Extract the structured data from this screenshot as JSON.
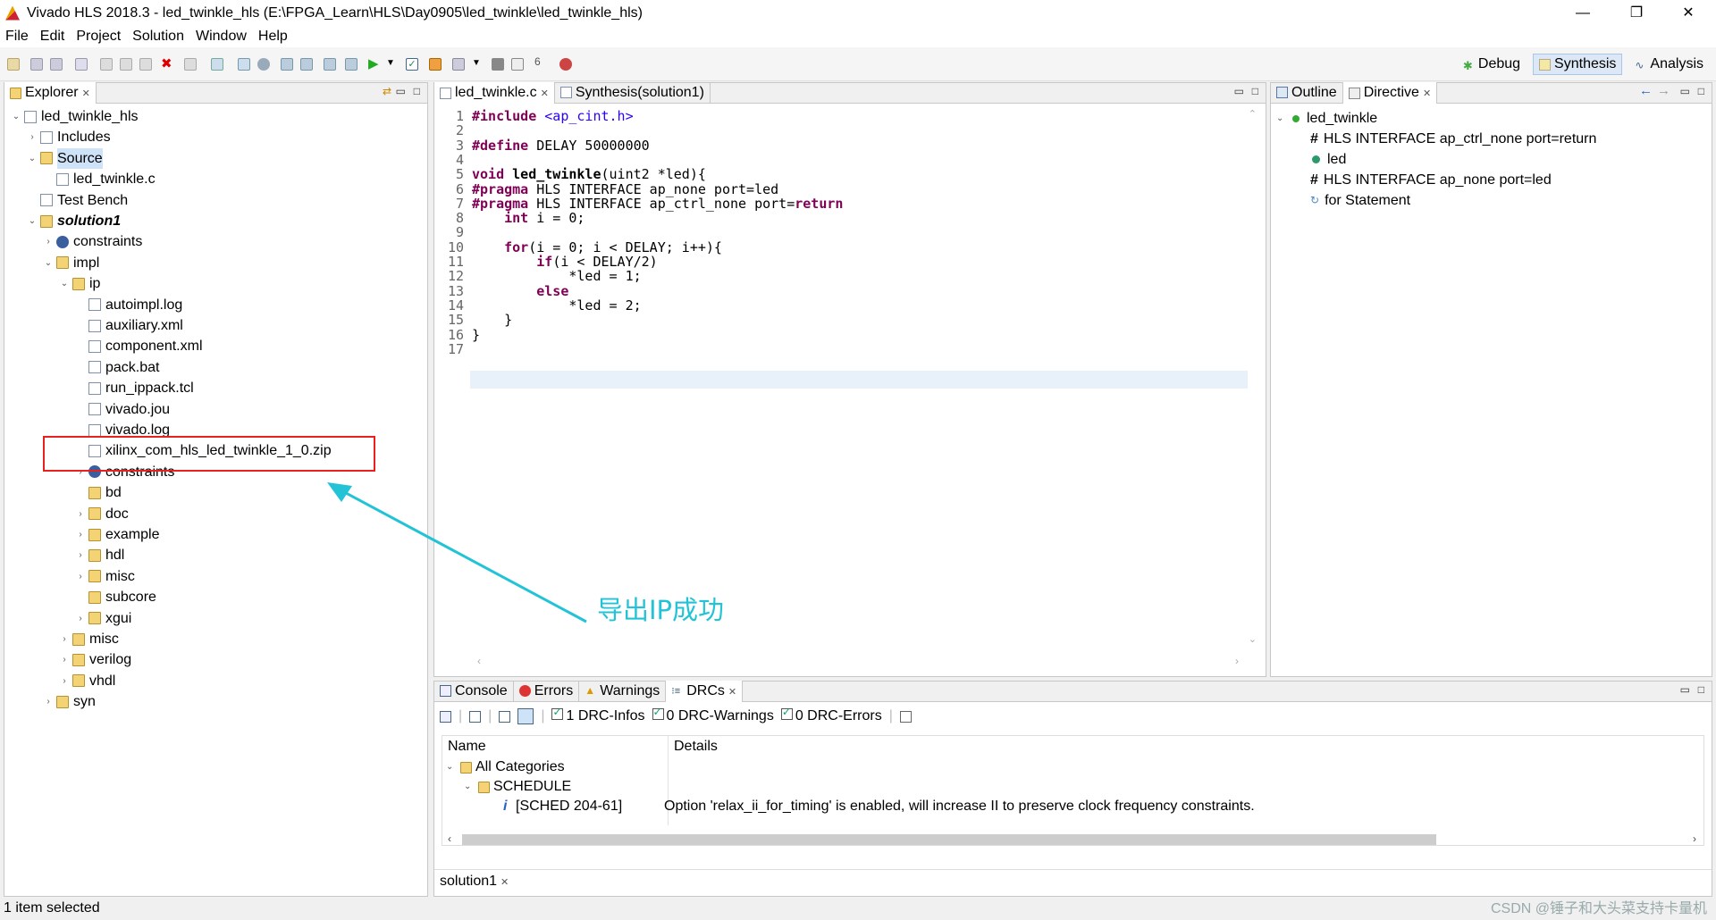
{
  "window": {
    "title": "Vivado HLS 2018.3 - led_twinkle_hls (E:\\FPGA_Learn\\HLS\\Day0905\\led_twinkle\\led_twinkle_hls)",
    "minimize": "—",
    "restore": "❐",
    "close": "✕"
  },
  "menu": [
    "File",
    "Edit",
    "Project",
    "Solution",
    "Window",
    "Help"
  ],
  "perspectives": {
    "debug": "Debug",
    "synthesis": "Synthesis",
    "analysis": "Analysis"
  },
  "explorer": {
    "tab": "Explorer",
    "items": [
      {
        "label": "led_twinkle_hls",
        "icon": "project-icon"
      },
      {
        "label": "Includes",
        "icon": "includes-icon"
      },
      {
        "label": "Source",
        "icon": "source-folder-icon"
      },
      {
        "label": "led_twinkle.c",
        "icon": "c-file-icon"
      },
      {
        "label": "Test Bench",
        "icon": "testbench-icon"
      },
      {
        "label": "solution1",
        "icon": "solution-folder-icon"
      },
      {
        "label": "constraints",
        "icon": "gear-icon"
      },
      {
        "label": "impl",
        "icon": "folder-icon"
      },
      {
        "label": "ip",
        "icon": "folder-icon"
      },
      {
        "label": "autoimpl.log",
        "icon": "file-icon"
      },
      {
        "label": "auxiliary.xml",
        "icon": "file-icon"
      },
      {
        "label": "component.xml",
        "icon": "file-icon"
      },
      {
        "label": "pack.bat",
        "icon": "file-icon"
      },
      {
        "label": "run_ippack.tcl",
        "icon": "tcl-file-icon"
      },
      {
        "label": "vivado.jou",
        "icon": "file-icon"
      },
      {
        "label": "vivado.log",
        "icon": "file-icon"
      },
      {
        "label": "xilinx_com_hls_led_twinkle_1_0.zip",
        "icon": "file-icon"
      },
      {
        "label": "constraints",
        "icon": "gear-icon"
      },
      {
        "label": "bd",
        "icon": "folder-icon"
      },
      {
        "label": "doc",
        "icon": "folder-icon"
      },
      {
        "label": "example",
        "icon": "folder-icon"
      },
      {
        "label": "hdl",
        "icon": "folder-icon"
      },
      {
        "label": "misc",
        "icon": "folder-icon"
      },
      {
        "label": "subcore",
        "icon": "folder-icon"
      },
      {
        "label": "xgui",
        "icon": "folder-icon"
      },
      {
        "label": "misc",
        "icon": "folder-icon"
      },
      {
        "label": "verilog",
        "icon": "folder-icon"
      },
      {
        "label": "vhdl",
        "icon": "folder-icon"
      },
      {
        "label": "syn",
        "icon": "folder-icon"
      }
    ]
  },
  "editor": {
    "tabs": [
      "led_twinkle.c",
      "Synthesis(solution1)"
    ],
    "lines": [
      "#include <ap_cint.h>",
      "",
      "#define DELAY 50000000",
      "",
      "void led_twinkle(uint2 *led){",
      "#pragma HLS INTERFACE ap_none port=led",
      "#pragma HLS INTERFACE ap_ctrl_none port=return",
      "    int i = 0;",
      "",
      "    for(i = 0; i < DELAY; i++){",
      "        if(i < DELAY/2)",
      "            *led = 1;",
      "        else",
      "            *led = 2;",
      "    }",
      "}",
      ""
    ]
  },
  "outline": {
    "tabs": [
      "Outline",
      "Directive"
    ],
    "items": [
      {
        "label": "led_twinkle",
        "icon": "function-icon"
      },
      {
        "label": "HLS INTERFACE ap_ctrl_none port=return",
        "icon": "pragma-hash-icon"
      },
      {
        "label": "led",
        "icon": "port-icon"
      },
      {
        "label": "HLS INTERFACE ap_none port=led",
        "icon": "pragma-hash-icon"
      },
      {
        "label": "for Statement",
        "icon": "loop-icon"
      }
    ]
  },
  "console": {
    "tabs": [
      "Console",
      "Errors",
      "Warnings",
      "DRCs"
    ],
    "filters": [
      "1 DRC-Infos",
      "0 DRC-Warnings",
      "0 DRC-Errors"
    ],
    "columns": [
      "Name",
      "Details"
    ],
    "rows": [
      {
        "name": "All Categories",
        "details": ""
      },
      {
        "name": "SCHEDULE",
        "details": ""
      },
      {
        "name": "[SCHED 204-61]",
        "details": "Option 'relax_ii_for_timing' is enabled, will increase II to preserve clock frequency constraints."
      }
    ],
    "footer_tab": "solution1"
  },
  "status": "1 item selected",
  "annotation": "导出IP成功",
  "watermark": "CSDN @锤子和大头菜支持卡量机",
  "colors": {
    "callout": "#e8211d",
    "arrow": "#22c3d6",
    "keyword": "#7f0055",
    "string": "#2a00ff"
  }
}
